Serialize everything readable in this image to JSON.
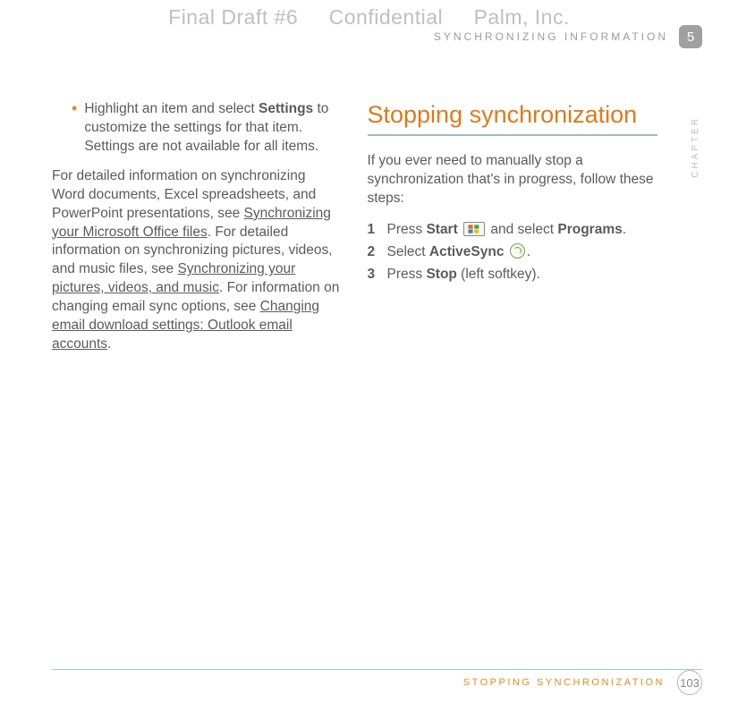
{
  "watermark": {
    "draft": "Final Draft #6",
    "confidential": "Confidential",
    "company": "Palm, Inc."
  },
  "header": {
    "section_label": "SYNCHRONIZING INFORMATION",
    "chapter_number": "5",
    "chapter_word": "CHAPTER"
  },
  "left_col": {
    "bullet_pre": "Highlight an item and select ",
    "bullet_bold": "Settings",
    "bullet_post": " to customize the settings for that item. Settings are not available for all items.",
    "para_a": "For detailed information on synchronizing Word documents, Excel spreadsheets, and PowerPoint presentations, see ",
    "link1": "Synchronizing your Microsoft Office files",
    "para_b": ". For detailed information on synchronizing pictures, videos, and music files, see ",
    "link2": "Synchronizing your pictures, videos, and music",
    "para_c": ". For information on changing email sync options, see ",
    "link3": "Changing email download settings: Outlook email accounts",
    "para_d": "."
  },
  "right_col": {
    "title": "Stopping synchronization",
    "intro": "If you ever need to manually stop a synchronization that's in progress, follow these steps:",
    "steps": {
      "n1": "1",
      "s1_a": "Press ",
      "s1_b": "Start",
      "s1_c": " and select ",
      "s1_d": "Programs",
      "s1_e": ".",
      "n2": "2",
      "s2_a": "Select ",
      "s2_b": "ActiveSync",
      "s2_c": ".",
      "n3": "3",
      "s3_a": "Press ",
      "s3_b": "Stop",
      "s3_c": " (left softkey)."
    }
  },
  "footer": {
    "label": "STOPPING SYNCHRONIZATION",
    "page": "103"
  }
}
